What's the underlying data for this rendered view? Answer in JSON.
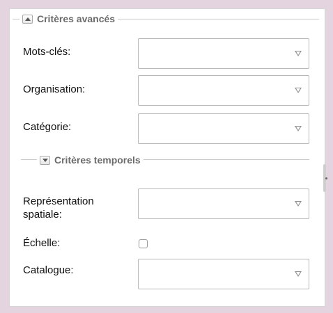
{
  "advanced_section": {
    "title": "Critères avancés",
    "toggle_icon": "collapse-arrow-up"
  },
  "fields": {
    "keywords_label": "Mots-clés:",
    "organisation_label": "Organisation:",
    "category_label": "Catégorie:",
    "spatial_rep_label_line1": "Représentation",
    "spatial_rep_label_line2": "spatiale:",
    "scale_label": "Échelle:",
    "catalogue_label": "Catalogue:"
  },
  "temporal_section": {
    "title": "Critères temporels",
    "toggle_icon": "expand-arrow-down"
  },
  "scale_checked": false,
  "colors": {
    "background": "#e3d4e0",
    "legend_text": "#6b6b6b",
    "border": "#b7b7b7"
  }
}
